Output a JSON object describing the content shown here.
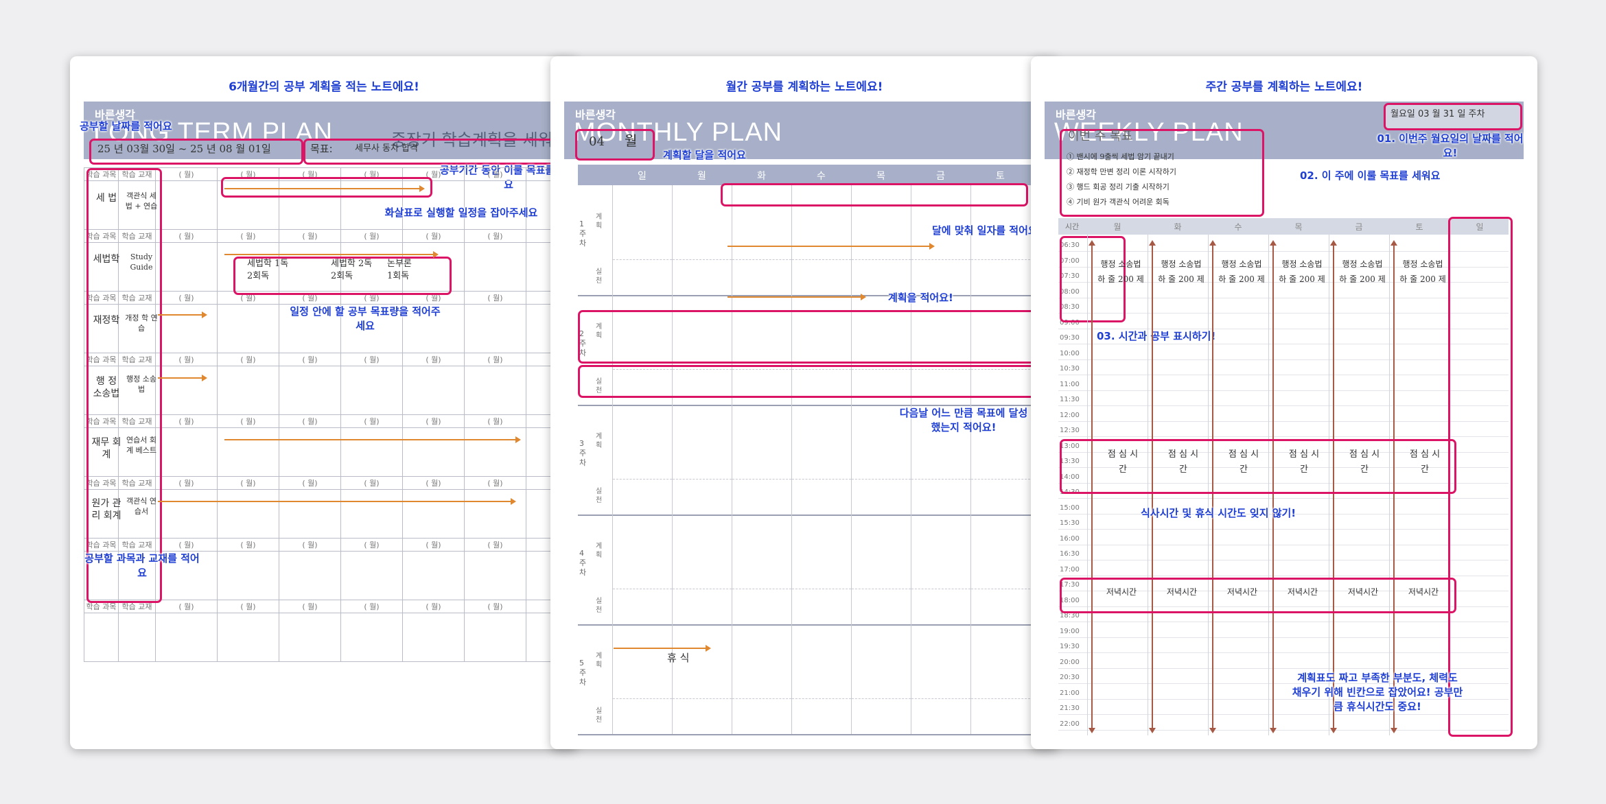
{
  "colors": {
    "accent": "#dc1466",
    "annotation": "#1f3fd2",
    "banner": "#a7b0c8",
    "arrow": "#e08830"
  },
  "long": {
    "top_note": "6개월간의 공부 계획을 적는 노트에요!",
    "brand": "바른생각",
    "plan": "LONG TERM PLAN",
    "subtitle": "중장기 학습계획을 세워주세요",
    "date_field": "25 년 03월 30일 ~ 25 년 08 월 01일",
    "goal_label": "목표:",
    "goal_value": "세무사 동차 합격",
    "col_subject": "학습 과목",
    "col_book": "학습 교재",
    "month_blank": "(      월)",
    "subjects": [
      "세 법",
      "세법학",
      "재정학",
      "행 정 소송법",
      "재무 회계",
      "원가 관리 회계"
    ],
    "books": [
      "객관식 세법 + 연습",
      "Study Guide",
      "개정 학 연습",
      "행정 소송 법",
      "연습서 회계 베스트",
      "객관식 연습서"
    ],
    "annotations": {
      "date": "공부할 날짜를 적어요",
      "period_goal": "공부기간 동안 이룰 목표를 적어요",
      "arrows": "화살표로 실행할 일정을 잡아주세요",
      "amount": "일정 안에 할 공부 목표량을 적어주세요",
      "subjects": "공부할 과목과 교재를 적어요"
    }
  },
  "monthly": {
    "top_note": "월간 공부를 계획하는 노트에요!",
    "brand": "바른생각",
    "plan": "MONTHLY PLAN",
    "month_value": "04",
    "month_unit": "월",
    "weekdays": [
      "일",
      "월",
      "화",
      "수",
      "목",
      "금",
      "토"
    ],
    "weeks": [
      "1 주차",
      "2 주차",
      "3 주차",
      "4 주차",
      "5 주차"
    ],
    "row_plan": "계획",
    "row_done": "실천",
    "annotations": {
      "month": "계획할 달을 적어요",
      "dates": "달에 맞춰 일자를 적어요",
      "plans": "계획을 적어요!",
      "done": "다음날 어느 만큼 목표에 달성했는지 적어요!"
    }
  },
  "weekly": {
    "top_note": "주간 공부를 계획하는 노트에요!",
    "brand": "바른생각",
    "plan": "WEEKLY PLAN",
    "week_label": "월요일 03 월 31 일 주차",
    "goal_title": "이번 주 목표",
    "goals": [
      "① 밴시에 9출씩 세법 암기 끝내기",
      "② 재정학 만변 정리 이론 시작하기",
      "③ 행드 회공 정리 기출 시작하기",
      "④ 기비 원가 객관식 어려운 회독"
    ],
    "time_head": "시간",
    "days": [
      "월",
      "화",
      "수",
      "목",
      "금",
      "토",
      "일"
    ],
    "times": [
      "06:30",
      "07:00",
      "07:30",
      "08:00",
      "08:30",
      "09:00",
      "09:30",
      "10:00",
      "10:30",
      "11:00",
      "11:30",
      "12:00",
      "12:30",
      "13:00",
      "13:30",
      "14:00",
      "14:30",
      "15:00",
      "15:30",
      "16:00",
      "16:30",
      "17:00",
      "17:30",
      "18:00",
      "18:30",
      "19:00",
      "19:30",
      "20:00",
      "20:30",
      "21:00",
      "21:30",
      "22:00"
    ],
    "morning": "행정 소송법 하 줄 200 제",
    "lunch": "점 심 시 간",
    "dinner": "저녁시간",
    "annotations": {
      "date": "01. 이번주 월요일의 날짜를 적어요!",
      "goal": "02. 이 주에 이룰 목표를 세워요",
      "time": "03. 시간과 공부 표시하기!",
      "meal": "식사시간 및 휴식 시간도 잊지 않기!",
      "rest": "계획표도 짜고 부족한 부분도, 체력도 채우기 위해 빈칸으로 잡았어요! 공부만큼 휴식시간도 중요!"
    }
  }
}
